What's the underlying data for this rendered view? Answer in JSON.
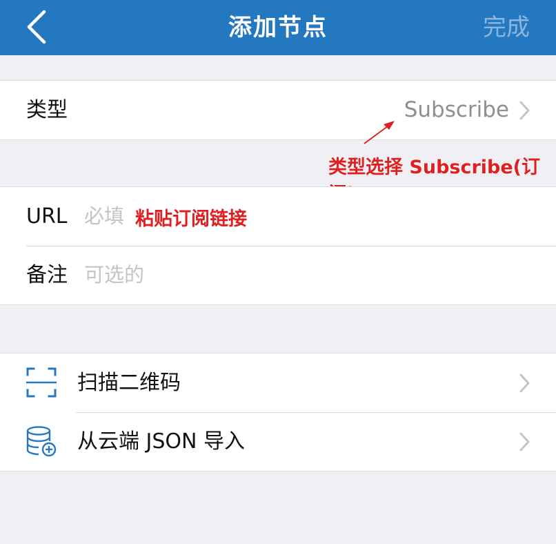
{
  "navbar": {
    "title": "添加节点",
    "done_label": "完成",
    "back_icon": "chevron-left-icon",
    "bg_color": "#2478c0"
  },
  "type_row": {
    "label": "类型",
    "value": "Subscribe",
    "chevron_icon": "chevron-right-icon"
  },
  "annotation_type": "类型选择 Subscribe(订阅)",
  "url_row": {
    "label": "URL",
    "placeholder": "必填",
    "annotation": "粘贴订阅链接"
  },
  "remark_row": {
    "label": "备注",
    "placeholder": "可选的"
  },
  "actions": [
    {
      "label": "扫描二维码",
      "icon": "qr-scan-icon"
    },
    {
      "label": "从云端 JSON 导入",
      "icon": "database-add-icon"
    }
  ],
  "colors": {
    "accent": "#2478c0",
    "annotation": "#e02020",
    "background": "#efeff4"
  }
}
